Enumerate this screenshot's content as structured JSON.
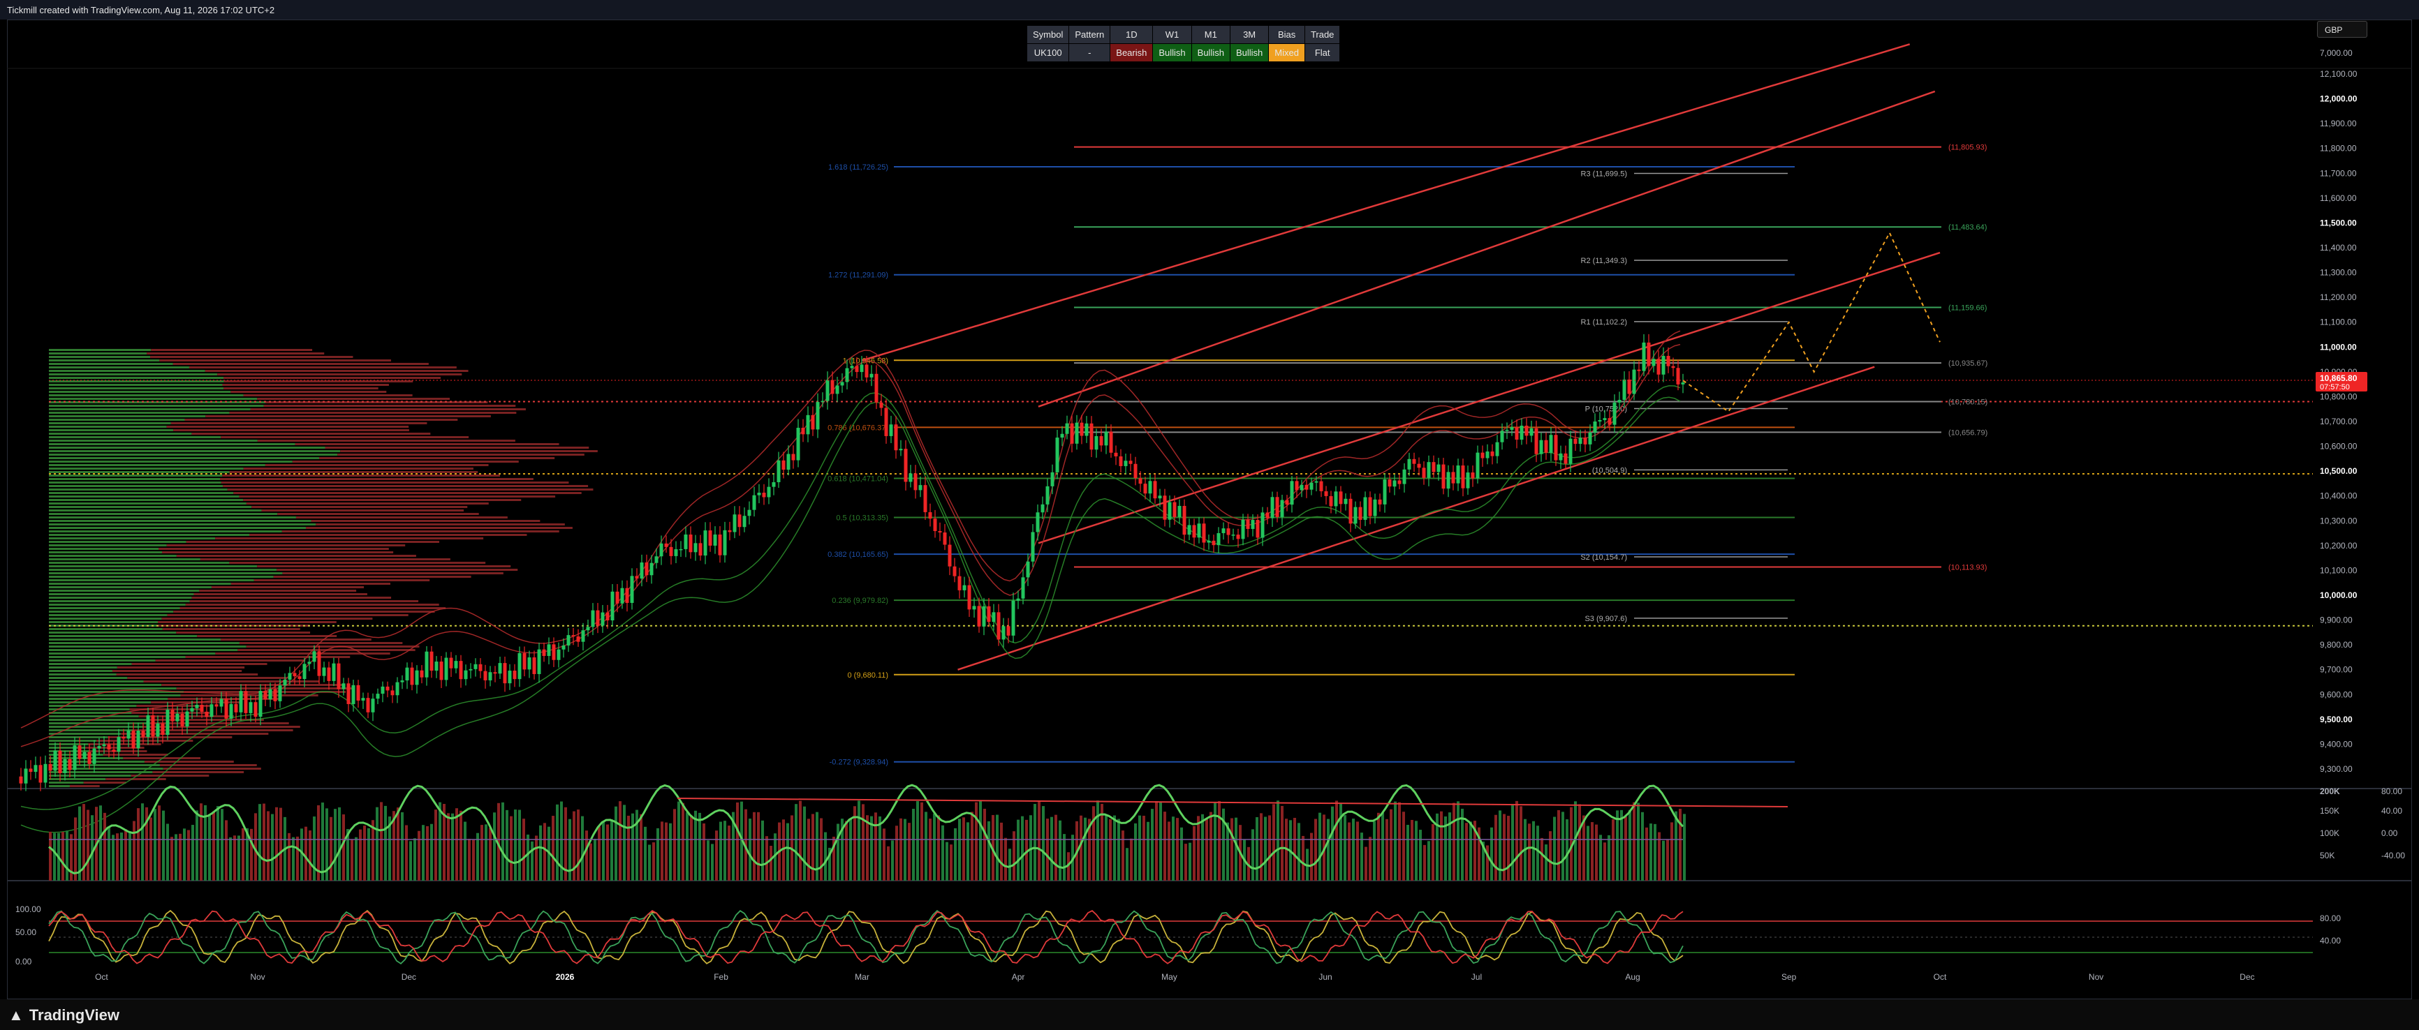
{
  "header": {
    "title": "Tickmill created with TradingView.com, Aug 11, 2026 17:02 UTC+2",
    "currency": "GBP"
  },
  "footer": {
    "logo": "TradingView"
  },
  "bias_table": {
    "headers": [
      "Symbol",
      "Pattern",
      "1D",
      "W1",
      "M1",
      "3M",
      "Bias",
      "Trade"
    ],
    "row": [
      "UK100",
      "-",
      "Bearish",
      "Bullish",
      "Bullish",
      "Bullish",
      "Mixed",
      "Flat"
    ],
    "row_colors": [
      "#2a2e39",
      "#2a2e39",
      "#7a1515",
      "#0f5f15",
      "#0f5f15",
      "#0f5f15",
      "#f0a020",
      "#2a2e39"
    ]
  },
  "chart_data": [
    {
      "type": "candlestick",
      "title": "",
      "x_ticks": [
        "Oct",
        "Nov",
        "Dec",
        "2026",
        "Feb",
        "Mar",
        "Apr",
        "May",
        "Jun",
        "Jul",
        "Aug",
        "Sep",
        "Oct",
        "Nov",
        "Dec"
      ],
      "y_ticks": [
        "12,100.00",
        "12,000.00",
        "11,900.00",
        "11,800.00",
        "11,700.00",
        "11,600.00",
        "11,500.00",
        "11,400.00",
        "11,300.00",
        "11,200.00",
        "11,100.00",
        "11,000.00",
        "10,900.00",
        "10,800.00",
        "10,700.00",
        "10,600.00",
        "10,500.00",
        "10,400.00",
        "10,300.00",
        "10,200.00",
        "10,100.00",
        "10,000.00",
        "9,900.00",
        "9,800.00",
        "9,700.00",
        "9,600.00",
        "9,500.00",
        "9,400.00",
        "9,300.00"
      ],
      "y_tick_values": [
        12100,
        12000,
        11900,
        11800,
        11700,
        11600,
        11500,
        11400,
        11300,
        11200,
        11100,
        11000,
        10900,
        10800,
        10700,
        10600,
        10500,
        10400,
        10300,
        10200,
        10100,
        10000,
        9900,
        9800,
        9700,
        9600,
        9500,
        9400,
        9300
      ],
      "bold_ticks": [
        "12,000.00",
        "11,500.00",
        "11,000.00",
        "10,500.00",
        "10,000.00",
        "9,500.00"
      ],
      "top_axis_label": "7,000.00",
      "ylim": [
        9255,
        12250
      ],
      "last_price": "10,865.80",
      "countdown": "07:57:50",
      "price_path": [
        [
          "2025-09-15",
          9270
        ],
        [
          "2025-10-01",
          9380
        ],
        [
          "2025-10-20",
          9540
        ],
        [
          "2025-11-01",
          9560
        ],
        [
          "2025-11-12",
          9740
        ],
        [
          "2025-11-22",
          9560
        ],
        [
          "2025-12-05",
          9720
        ],
        [
          "2025-12-20",
          9680
        ],
        [
          "2026-01-01",
          9800
        ],
        [
          "2026-01-10",
          9950
        ],
        [
          "2026-01-20",
          10180
        ],
        [
          "2026-02-01",
          10220
        ],
        [
          "2026-02-12",
          10480
        ],
        [
          "2026-02-22",
          10820
        ],
        [
          "2026-03-01",
          10940
        ],
        [
          "2026-03-08",
          10580
        ],
        [
          "2026-03-15",
          10300
        ],
        [
          "2026-03-22",
          9960
        ],
        [
          "2026-03-30",
          9850
        ],
        [
          "2026-04-05",
          10320
        ],
        [
          "2026-04-10",
          10680
        ],
        [
          "2026-04-18",
          10620
        ],
        [
          "2026-04-28",
          10400
        ],
        [
          "2026-05-08",
          10220
        ],
        [
          "2026-05-18",
          10280
        ],
        [
          "2026-05-28",
          10460
        ],
        [
          "2026-06-08",
          10320
        ],
        [
          "2026-06-18",
          10530
        ],
        [
          "2026-06-28",
          10460
        ],
        [
          "2026-07-08",
          10680
        ],
        [
          "2026-07-18",
          10560
        ],
        [
          "2026-07-28",
          10740
        ],
        [
          "2026-08-03",
          10960
        ],
        [
          "2026-08-08",
          10920
        ],
        [
          "2026-08-11",
          10865
        ]
      ],
      "fib_levels": [
        {
          "label": "1.618 (11,726.25)",
          "value": 11726.25,
          "color": "#1e4fa8"
        },
        {
          "label": "1.272 (11,291.09)",
          "value": 11291.09,
          "color": "#1e4fa8"
        },
        {
          "label": "1 (10,946.58)",
          "value": 10946.58,
          "color": "#d4a017"
        },
        {
          "label": "0.786 (10,676.37)",
          "value": 10676.37,
          "color": "#c05010"
        },
        {
          "label": "0.618 (10,471.04)",
          "value": 10471.04,
          "color": "#2a7a2a"
        },
        {
          "label": "0.5 (10,313.35)",
          "value": 10313.35,
          "color": "#2a7a2a"
        },
        {
          "label": "0.382 (10,165.65)",
          "value": 10165.65,
          "color": "#1e4fa8"
        },
        {
          "label": "0.236 (9,979.82)",
          "value": 9979.82,
          "color": "#2a7a2a"
        },
        {
          "label": "0 (9,680.11)",
          "value": 9680.11,
          "color": "#d4a017"
        },
        {
          "label": "-0.272 (9,328.94)",
          "value": 9328.94,
          "color": "#1e4fa8"
        }
      ],
      "pivots": [
        {
          "label": "R3 (11,699.5)",
          "value": 11699.5
        },
        {
          "label": "R2 (11,349.3)",
          "value": 11349.3
        },
        {
          "label": "R1 (11,102.2)",
          "value": 11102.2
        },
        {
          "label": "P (10,752.0)",
          "value": 10752.0
        },
        {
          "label": "(10,504.9)",
          "value": 10504.9
        },
        {
          "label": "S2 (10,154.7)",
          "value": 10154.7
        },
        {
          "label": "S3 (9,907.6)",
          "value": 9907.6
        }
      ],
      "zones": [
        {
          "label": "(11,805.93)",
          "value": 11805.93,
          "color": "#e03a3a"
        },
        {
          "label": "(11,483.64)",
          "value": 11483.64,
          "color": "#3aa35a"
        },
        {
          "label": "(11,159.66)",
          "value": 11159.66,
          "color": "#3aa35a"
        },
        {
          "label": "(10,935.67)",
          "value": 10935.67,
          "color": "#888888"
        },
        {
          "label": "(10,780.15)",
          "value": 10780.15,
          "color": "#888888"
        },
        {
          "label": "(10,656.79)",
          "value": 10656.79,
          "color": "#888888"
        },
        {
          "label": "(10,113.93)",
          "value": 10113.93,
          "color": "#e03a3a"
        }
      ],
      "channel_lines": [
        {
          "from": [
            "2026-03-01",
            10946
          ],
          "to": [
            "2026-09-25",
            12220
          ]
        },
        {
          "from": [
            "2026-04-05",
            10760
          ],
          "to": [
            "2026-09-30",
            12030
          ]
        },
        {
          "from": [
            "2026-04-05",
            10210
          ],
          "to": [
            "2026-10-01",
            11380
          ]
        },
        {
          "from": [
            "2026-03-20",
            9700
          ],
          "to": [
            "2026-09-18",
            10920
          ]
        }
      ],
      "projection": [
        [
          "2026-08-11",
          10865
        ],
        [
          "2026-08-20",
          10740
        ],
        [
          "2026-09-01",
          11100
        ],
        [
          "2026-09-06",
          10900
        ],
        [
          "2026-09-21",
          11460
        ],
        [
          "2026-10-01",
          11020
        ]
      ],
      "dotted_levels": [
        {
          "value": 10780,
          "color": "#e03a3a"
        },
        {
          "value": 10489,
          "color": "#d4a017"
        },
        {
          "value": 9877,
          "color": "#c8c83a"
        }
      ]
    },
    {
      "type": "bar",
      "title": "Volume",
      "y_ticks": [
        "200K",
        "150K",
        "100K",
        "50K"
      ],
      "right_ticks": [
        "80.00",
        "40.00",
        "0.00",
        "-40.00"
      ]
    },
    {
      "type": "line",
      "title": "Oscillator",
      "y_ticks": [
        "100.00",
        "50.00",
        "0.00"
      ],
      "right_ticks": [
        "80.00",
        "40.00"
      ]
    }
  ]
}
